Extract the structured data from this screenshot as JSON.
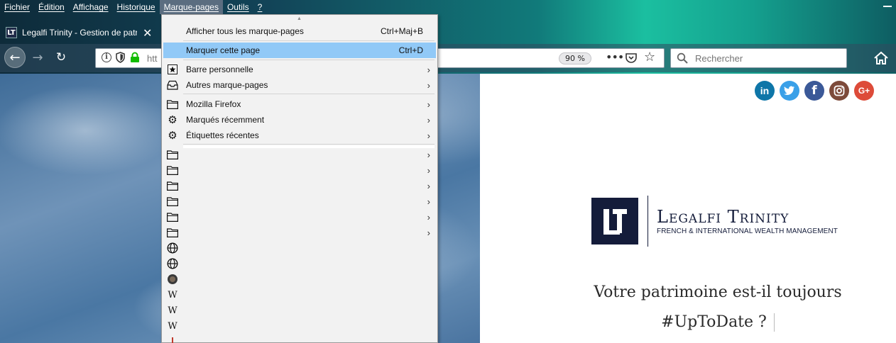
{
  "menubar": {
    "items": [
      "Fichier",
      "Édition",
      "Affichage",
      "Historique",
      "Marque-pages",
      "Outils",
      "?"
    ],
    "active_index": 4
  },
  "tab": {
    "title": "Legalfi Trinity - Gestion de patrimoine",
    "favicon_letter": "LT"
  },
  "urlbar": {
    "url_prefix": "htt",
    "zoom": "90 %"
  },
  "searchbar": {
    "placeholder": "Rechercher"
  },
  "bookmarks_menu": {
    "show_all": {
      "label": "Afficher tous les marque-pages",
      "shortcut": "Ctrl+Maj+B"
    },
    "bookmark_page": {
      "label": "Marquer cette page",
      "shortcut": "Ctrl+D"
    },
    "toolbar": {
      "label": "Barre personnelle"
    },
    "other": {
      "label": "Autres marque-pages"
    },
    "mozilla": {
      "label": "Mozilla Firefox"
    },
    "recent": {
      "label": "Marqués récemment"
    },
    "recent_tags": {
      "label": "Étiquettes récentes"
    },
    "wiki_glyph": "W"
  },
  "page": {
    "brand_name": "Legalfi Trinity",
    "brand_tagline": "FRENCH & INTERNATIONAL WEALTH MANAGEMENT",
    "headline_line1": "Votre patrimoine est-il toujours",
    "headline_line2": "#UpToDate ?",
    "social": {
      "linkedin": "in",
      "facebook": "f",
      "googleplus": "G+"
    }
  },
  "colors": {
    "highlight": "#91c9f7",
    "brand_navy": "#141c3a"
  }
}
